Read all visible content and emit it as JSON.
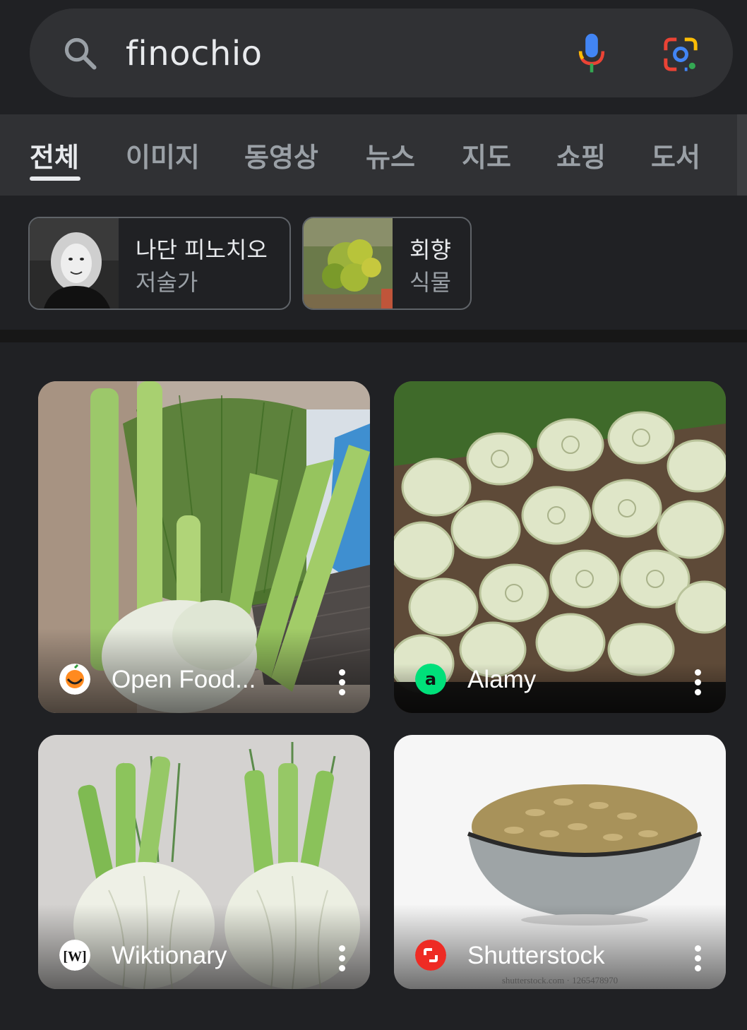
{
  "search": {
    "query": "finochio"
  },
  "tabs": [
    {
      "label": "전체",
      "active": true
    },
    {
      "label": "이미지"
    },
    {
      "label": "동영상"
    },
    {
      "label": "뉴스"
    },
    {
      "label": "지도"
    },
    {
      "label": "쇼핑"
    },
    {
      "label": "도서"
    }
  ],
  "chips": [
    {
      "title": "나단 피노치오",
      "subtitle": "저술가"
    },
    {
      "title": "회향",
      "subtitle": "식물"
    }
  ],
  "results": [
    {
      "source": "Open Food...",
      "icon": "open-food-facts-icon"
    },
    {
      "source": "Alamy",
      "icon": "alamy-icon"
    },
    {
      "source": "Wiktionary",
      "icon": "wiktionary-icon"
    },
    {
      "source": "Shutterstock",
      "icon": "shutterstock-icon",
      "watermark": "shutterstock.com · 1265478970"
    }
  ],
  "colors": {
    "background": "#202124",
    "surface": "#303134",
    "alamy_green": "#00e07a",
    "shutterstock_red": "#ee2b24"
  }
}
